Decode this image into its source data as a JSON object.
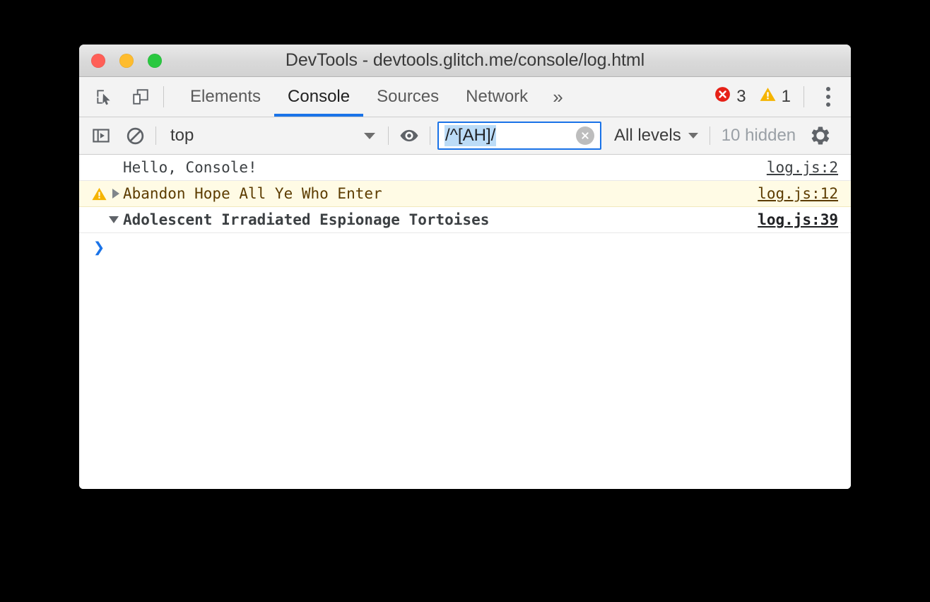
{
  "window": {
    "title": "DevTools - devtools.glitch.me/console/log.html",
    "traffic_lights": [
      {
        "name": "close",
        "color": "#ff5f57"
      },
      {
        "name": "minimize",
        "color": "#febc2e"
      },
      {
        "name": "zoom",
        "color": "#2ac840"
      }
    ]
  },
  "tabbar": {
    "icons": [
      {
        "name": "inspect-element-icon",
        "title": "Inspect element"
      },
      {
        "name": "device-toolbar-icon",
        "title": "Toggle device toolbar"
      }
    ],
    "tabs": [
      {
        "label": "Elements",
        "active": false
      },
      {
        "label": "Console",
        "active": true
      },
      {
        "label": "Sources",
        "active": false
      },
      {
        "label": "Network",
        "active": false
      }
    ],
    "more_label": "»",
    "error_count": "3",
    "warning_count": "1",
    "error_color": "#e62117",
    "warning_color": "#f5b400",
    "accent_color": "#1a73e8",
    "menu_name": "main-menu-icon"
  },
  "filterbar": {
    "sidebar_toggle_name": "console-sidebar-toggle-icon",
    "clear_name": "clear-console-icon",
    "context": {
      "value": "top",
      "caret": "▼"
    },
    "live_expression_name": "eye-icon",
    "filter": {
      "value": "/^[AH]/",
      "placeholder": "Filter",
      "selected": true,
      "selection_color": "#bcdcf7",
      "focus_border_color": "#1a73e8",
      "clear_button_name": "filter-clear-icon"
    },
    "levels": {
      "label": "All levels",
      "caret": "▼"
    },
    "hidden_label": "10 hidden",
    "settings_name": "gear-icon"
  },
  "console": {
    "messages": [
      {
        "level": "log",
        "text": "Hello, Console!",
        "source": "log.js:2",
        "has_icon": false,
        "disclosure": "none"
      },
      {
        "level": "warning",
        "text": "Abandon Hope All Ye Who Enter",
        "source": "log.js:12",
        "has_icon": true,
        "icon_name": "warning-triangle-icon",
        "disclosure": "collapsed"
      },
      {
        "level": "group",
        "text": "Adolescent Irradiated Espionage Tortoises",
        "source": "log.js:39",
        "has_icon": false,
        "disclosure": "expanded"
      }
    ],
    "prompt": {
      "caret": "❯",
      "value": ""
    }
  }
}
